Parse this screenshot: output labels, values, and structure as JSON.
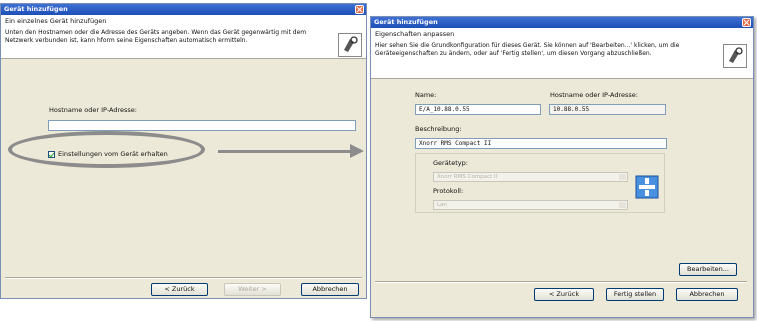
{
  "left_dialog": {
    "title": "Gerät hinzufügen",
    "header_title": "Ein einzelnes Gerät hinzufügen",
    "header_desc": "Unten den Hostnamen oder die Adresse des Geräts angeben. Wenn das Gerät gegenwärtig mit dem Netzwerk verbunden ist, kann hform seine Eigenschaften automatisch ermitteln.",
    "host_label": "Hostname oder IP-Adresse:",
    "host_value": "",
    "checkbox_label": "Einstellungen vom Gerät erhalten",
    "checkbox_checked": true,
    "btn_back": "< Zurück",
    "btn_next": "Weiter >",
    "btn_cancel": "Abbrechen"
  },
  "right_dialog": {
    "title": "Gerät hinzufügen",
    "header_title": "Eigenschaften anpassen",
    "header_desc": "Hier sehen Sie die Grundkonfiguration für dieses Gerät. Sie können auf 'Bearbeiten...' klicken, um die Geräteeigenschaften zu ändern, oder auf 'Fertig stellen', um diesen Vorgang abzuschließen.",
    "name_label": "Name:",
    "name_value": "E/A_10.88.0.55",
    "host_label": "Hostname oder IP-Adresse:",
    "host_value": "10.88.0.55",
    "desc_label": "Beschreibung:",
    "desc_value": "Xnorr RMS Compact II",
    "devtype_label": "Gerätetyp:",
    "devtype_value": "Xnorr RMS Compact II",
    "protocol_label": "Protokoll:",
    "protocol_value": "Lan",
    "btn_edit": "Bearbeiten...",
    "btn_back": "< Zurück",
    "btn_finish": "Fertig stellen",
    "btn_cancel": "Abbrechen"
  },
  "colors": {
    "titlebar": "#1d4fb8",
    "annotation": "#8c8c8c",
    "dialog_bg": "#ece9d8"
  }
}
